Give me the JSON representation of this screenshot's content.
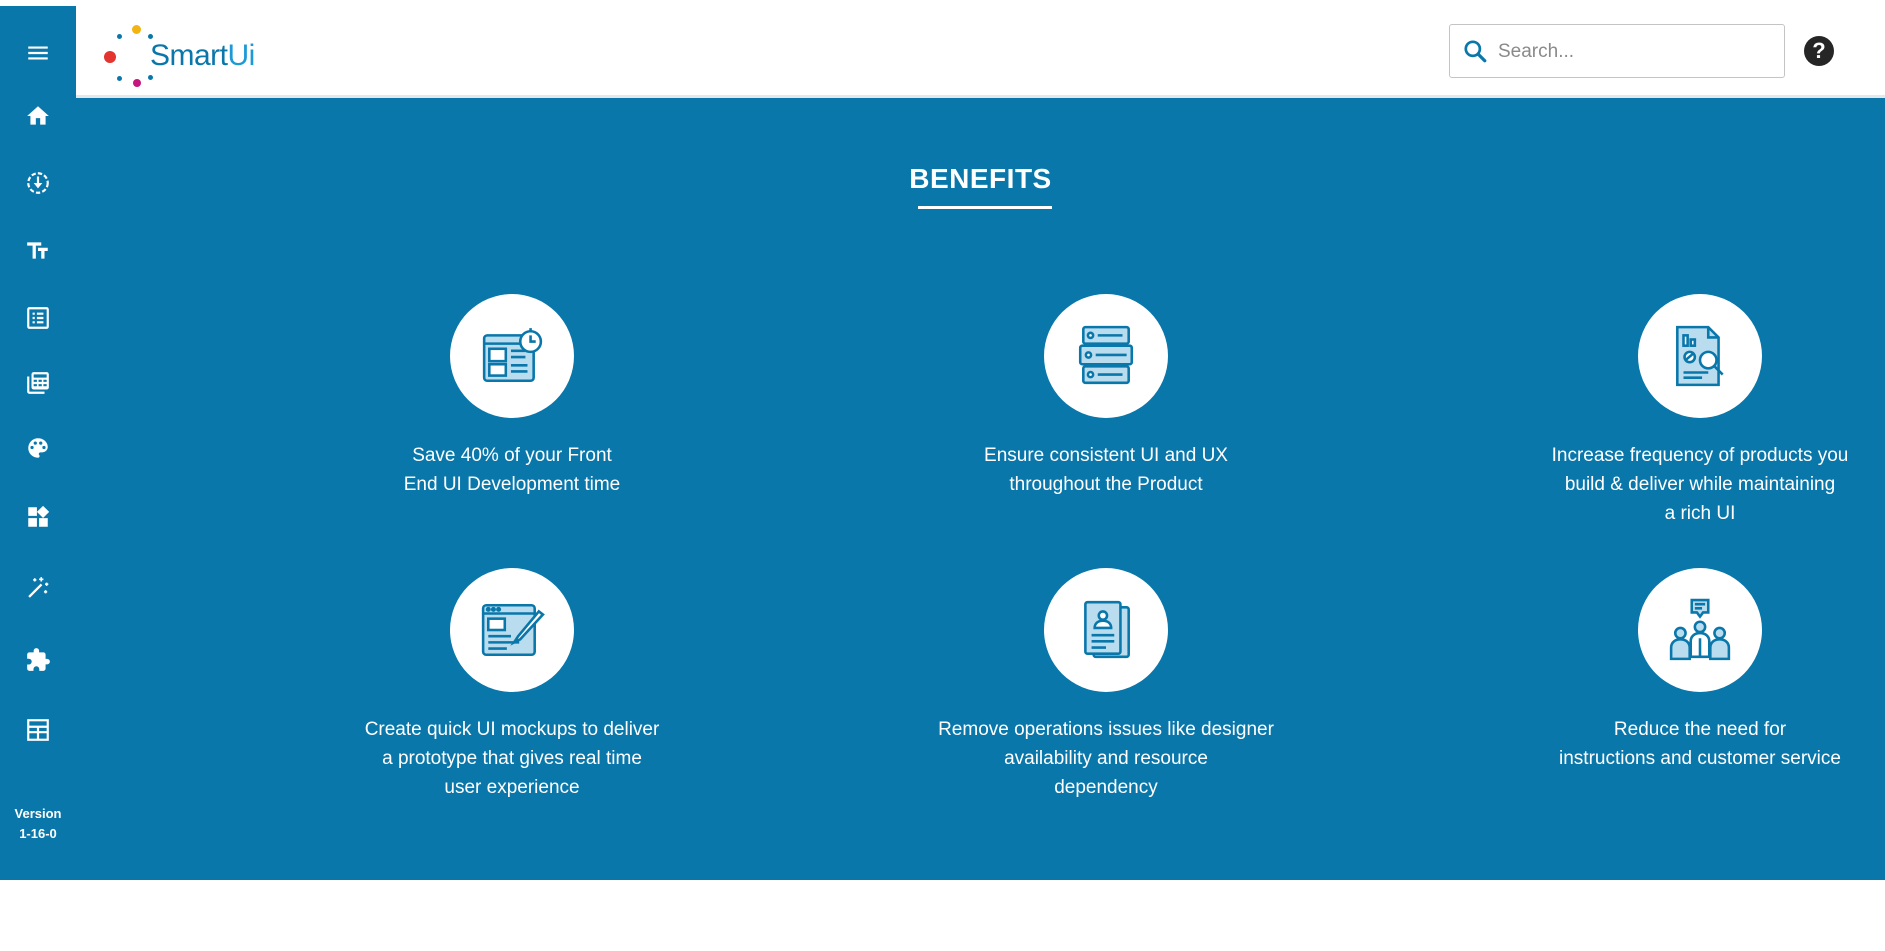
{
  "app": {
    "logo_text_smart": "Smart",
    "logo_text_ui": "Ui",
    "version_label": "Version",
    "version_number": "1-16-0"
  },
  "colors": {
    "primary": "#0a77ab",
    "surface": "#ffffff",
    "help_bg": "#262626"
  },
  "sidebar": {
    "items": [
      {
        "icon": "home-icon"
      },
      {
        "icon": "download-cycle-icon"
      },
      {
        "icon": "typography-icon"
      },
      {
        "icon": "list-icon"
      },
      {
        "icon": "calculator-icon"
      },
      {
        "icon": "palette-icon"
      },
      {
        "icon": "widgets-icon"
      },
      {
        "icon": "magic-wand-icon"
      },
      {
        "icon": "puzzle-icon"
      },
      {
        "icon": "table-icon"
      }
    ]
  },
  "header": {
    "search_placeholder": "Search...",
    "search_value": "",
    "help_icon": "help-icon"
  },
  "main": {
    "title": "BENEFITS",
    "benefits": [
      {
        "icon": "timer-browser-icon",
        "text": "Save 40% of your Front\nEnd UI Development time"
      },
      {
        "icon": "server-stack-icon",
        "text": "Ensure consistent UI and UX\nthroughout the Product"
      },
      {
        "icon": "report-search-icon",
        "text": "Increase frequency of products you\nbuild & deliver while maintaining\na rich UI"
      },
      {
        "icon": "design-brush-icon",
        "text": "Create quick UI mockups to deliver\na prototype that gives real time\nuser experience"
      },
      {
        "icon": "profile-documents-icon",
        "text": "Remove operations issues like designer\navailability and resource\ndependency"
      },
      {
        "icon": "team-support-icon",
        "text": "Reduce the need for\ninstructions and customer service"
      }
    ]
  },
  "scroll_top_icon": "arrow-up-icon"
}
